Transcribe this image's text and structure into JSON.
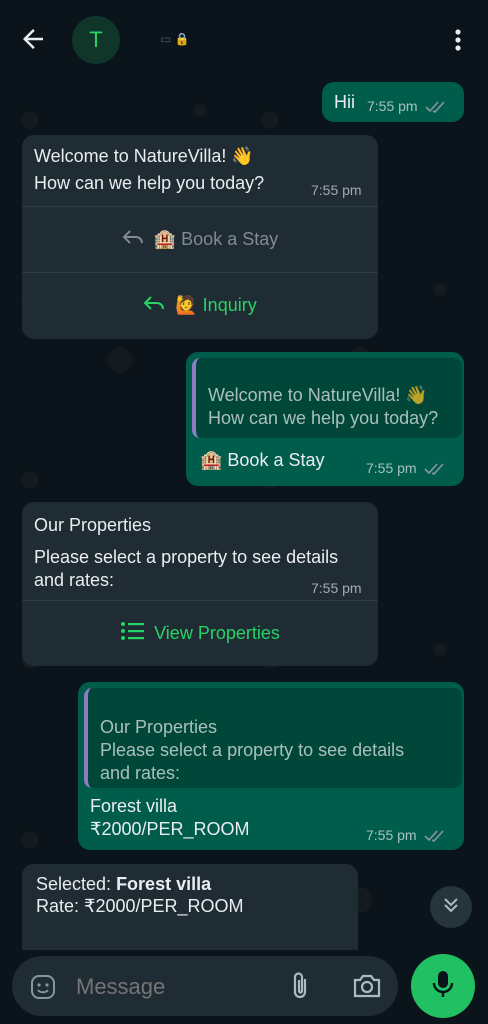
{
  "header": {
    "avatar_letter": "T",
    "status_icons": "▭ 🔒"
  },
  "messages": {
    "m1": {
      "text": "Hii",
      "time": "7:55 pm"
    },
    "m2": {
      "line1": "Welcome to NatureVilla! 👋",
      "line2": "How can we help you today?",
      "time": "7:55 pm",
      "button1": "🏨 Book a Stay",
      "button2": "🙋 Inquiry"
    },
    "m3": {
      "quote_line1": "Welcome to NatureVilla! 👋",
      "quote_line2": "How can we help you today?",
      "text": "🏨 Book a Stay",
      "time": "7:55 pm"
    },
    "m4": {
      "title": "Our Properties",
      "line1": "Please select a property to see details",
      "line2": "and rates:",
      "time": "7:55 pm",
      "button": "View Properties"
    },
    "m5": {
      "quote_title": "Our Properties",
      "quote_line1": "Please select a property to see details",
      "quote_line2": "and rates:",
      "line1": "Forest villa",
      "line2": "₹2000/PER_ROOM",
      "time": "7:55 pm"
    },
    "m6": {
      "selected_label": "Selected: ",
      "selected_value": "Forest villa",
      "rate_line": "Rate: ₹2000/PER_ROOM"
    }
  },
  "composer": {
    "placeholder": "Message"
  },
  "colors": {
    "background": "#0b141a",
    "incoming": "#202c33",
    "outgoing": "#005c4b",
    "accent": "#25d366",
    "tick": "#8696a0"
  },
  "icons": [
    "back-arrow-icon",
    "kebab-menu-icon",
    "reply-icon",
    "list-icon",
    "emoji-icon",
    "attach-icon",
    "camera-icon",
    "mic-icon",
    "chevron-double-down-icon"
  ]
}
